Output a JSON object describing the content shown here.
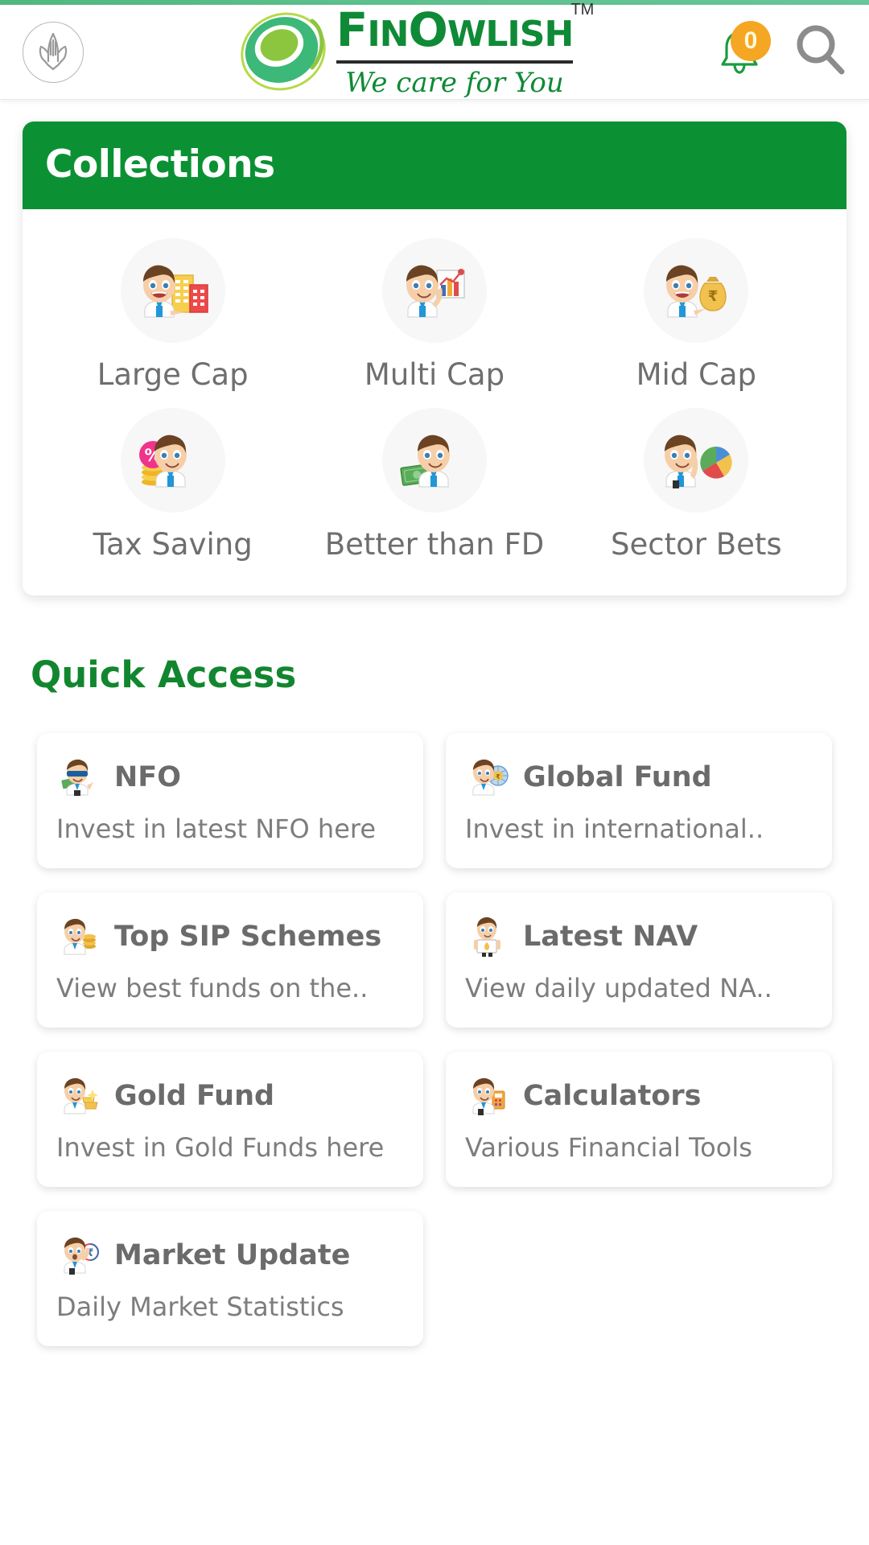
{
  "header": {
    "avatar_icon": "namaste-hands-icon",
    "brand": {
      "name_part1": "F",
      "name_part2": "IN",
      "name_part3": "O",
      "name_part4": "WLISH",
      "full_name": "FinOwlish",
      "tagline": "We care for You",
      "trademark": "TM"
    },
    "notification": {
      "icon": "bell-icon",
      "count": "0"
    },
    "search": {
      "icon": "search-icon"
    }
  },
  "collections": {
    "title": "Collections",
    "items": [
      {
        "label": "Large Cap",
        "icon": "man-with-buildings-icon"
      },
      {
        "label": "Multi Cap",
        "icon": "man-with-bar-chart-icon"
      },
      {
        "label": "Mid Cap",
        "icon": "man-with-money-bag-icon"
      },
      {
        "label": "Tax Saving",
        "icon": "man-with-percent-coin-icon"
      },
      {
        "label": "Better than FD",
        "icon": "man-with-cash-icon"
      },
      {
        "label": "Sector Bets",
        "icon": "man-with-pie-chart-icon"
      }
    ]
  },
  "quick_access": {
    "title": "Quick Access",
    "cards": [
      {
        "name": "NFO",
        "desc": "Invest in latest NFO here",
        "icon": "man-sunglasses-cash-icon"
      },
      {
        "name": "Global Fund",
        "desc": "Invest in international..",
        "icon": "man-globe-rupee-icon"
      },
      {
        "name": "Top SIP Schemes",
        "desc": "View best funds on the..",
        "icon": "man-gold-coins-icon"
      },
      {
        "name": "Latest NAV",
        "desc": "View daily updated NA..",
        "icon": "man-holding-board-icon"
      },
      {
        "name": "Gold Fund",
        "desc": "Invest in Gold Funds here",
        "icon": "man-gold-bars-icon"
      },
      {
        "name": "Calculators",
        "desc": "Various Financial Tools",
        "icon": "man-calculator-icon"
      },
      {
        "name": "Market Update",
        "desc": "Daily Market Statistics",
        "icon": "man-rupee-symbol-icon"
      }
    ]
  },
  "colors": {
    "brand_green": "#0b9134",
    "accent_green": "#12862f",
    "badge_orange": "#f5a623",
    "label_gray": "#6e6e6e",
    "page_bg": "#ffffff"
  }
}
